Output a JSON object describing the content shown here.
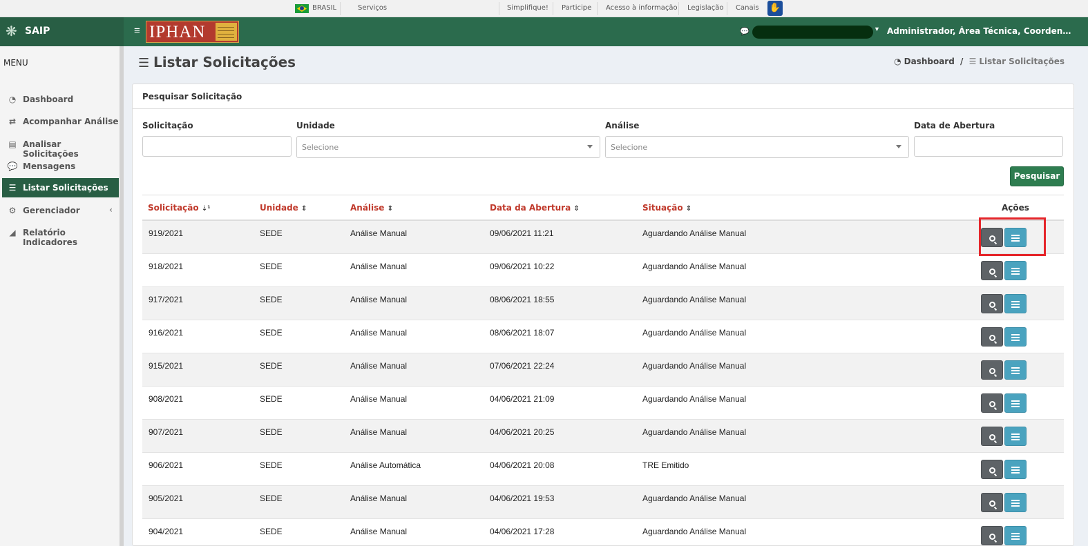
{
  "govbar": {
    "country": "BRASIL",
    "links": [
      "Serviços",
      "Simplifique!",
      "Participe",
      "Acesso à informação",
      "Legislação",
      "Canais"
    ]
  },
  "header": {
    "app_name": "SAIP",
    "logo_text": "IPHAN",
    "user_roles": "Administrador, Área Técnica, Coordenação..."
  },
  "sidebar": {
    "title": "MENU",
    "items": [
      {
        "label": "Dashboard",
        "icon": "dashboard-icon"
      },
      {
        "label": "Acompanhar Análise",
        "icon": "exchange-icon"
      },
      {
        "label": "Analisar Solicitações",
        "icon": "book-icon"
      },
      {
        "label": "Mensagens",
        "icon": "comments-icon"
      },
      {
        "label": "Listar Solicitações",
        "icon": "list-icon",
        "active": true
      },
      {
        "label": "Gerenciador",
        "icon": "cogs-icon",
        "has_submenu": true
      },
      {
        "label": "Relatório Indicadores",
        "icon": "area-chart-icon"
      }
    ]
  },
  "page": {
    "title": "Listar Solicitações",
    "breadcrumb": [
      "Dashboard",
      "/",
      "Listar Solicitações"
    ]
  },
  "search": {
    "panel_title": "Pesquisar Solicitação",
    "fields": {
      "solicitacao": {
        "label": "Solicitação",
        "value": ""
      },
      "unidade": {
        "label": "Unidade",
        "placeholder": "Selecione"
      },
      "analise": {
        "label": "Análise",
        "placeholder": "Selecione"
      },
      "data_abertura": {
        "label": "Data de Abertura",
        "value": ""
      }
    },
    "button": "Pesquisar"
  },
  "table": {
    "headers": [
      "Solicitação",
      "Unidade",
      "Análise",
      "Data da Abertura",
      "Situação",
      "Ações"
    ],
    "rows": [
      {
        "solicitacao": "919/2021",
        "unidade": "SEDE",
        "analise": "Análise Manual",
        "data": "09/06/2021 11:21",
        "situacao": "Aguardando Análise Manual"
      },
      {
        "solicitacao": "918/2021",
        "unidade": "SEDE",
        "analise": "Análise Manual",
        "data": "09/06/2021 10:22",
        "situacao": "Aguardando Análise Manual"
      },
      {
        "solicitacao": "917/2021",
        "unidade": "SEDE",
        "analise": "Análise Manual",
        "data": "08/06/2021 18:55",
        "situacao": "Aguardando Análise Manual"
      },
      {
        "solicitacao": "916/2021",
        "unidade": "SEDE",
        "analise": "Análise Manual",
        "data": "08/06/2021 18:07",
        "situacao": "Aguardando Análise Manual"
      },
      {
        "solicitacao": "915/2021",
        "unidade": "SEDE",
        "analise": "Análise Manual",
        "data": "07/06/2021 22:24",
        "situacao": "Aguardando Análise Manual"
      },
      {
        "solicitacao": "908/2021",
        "unidade": "SEDE",
        "analise": "Análise Manual",
        "data": "04/06/2021 21:09",
        "situacao": "Aguardando Análise Manual"
      },
      {
        "solicitacao": "907/2021",
        "unidade": "SEDE",
        "analise": "Análise Manual",
        "data": "04/06/2021 20:25",
        "situacao": "Aguardando Análise Manual"
      },
      {
        "solicitacao": "906/2021",
        "unidade": "SEDE",
        "analise": "Análise Automática",
        "data": "04/06/2021 20:08",
        "situacao": "TRE Emitido"
      },
      {
        "solicitacao": "905/2021",
        "unidade": "SEDE",
        "analise": "Análise Manual",
        "data": "04/06/2021 19:53",
        "situacao": "Aguardando Análise Manual"
      },
      {
        "solicitacao": "904/2021",
        "unidade": "SEDE",
        "analise": "Análise Manual",
        "data": "04/06/2021 17:28",
        "situacao": "Aguardando Análise Manual"
      }
    ]
  },
  "colors": {
    "header_green": "#2b6b4d",
    "brand_green": "#285e44",
    "sort_header_red": "#c0392b",
    "button_green": "#2e7d50",
    "view_button_gray": "#5e6367",
    "list_button_blue": "#4aa3bf",
    "highlight_red": "#e5252a"
  }
}
